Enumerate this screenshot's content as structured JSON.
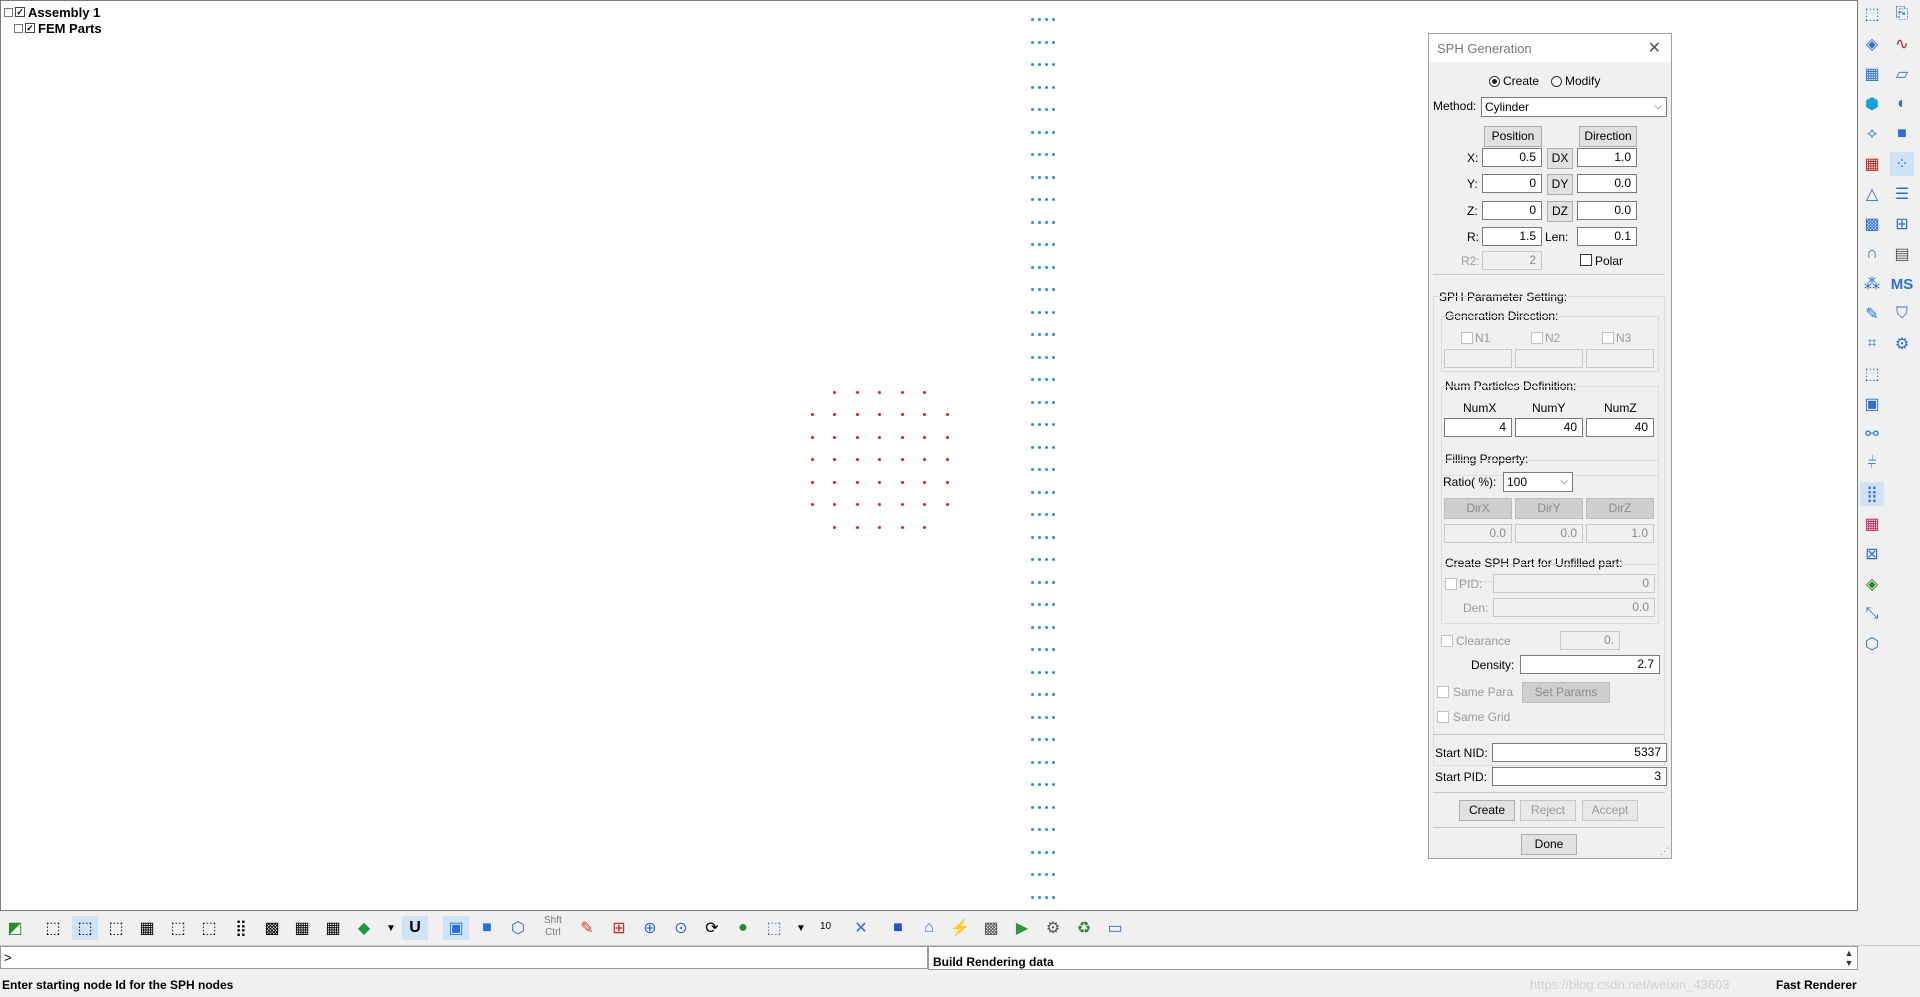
{
  "tree": {
    "root_label": "Assembly 1",
    "child_label": "FEM Parts"
  },
  "dialog": {
    "title": "SPH Generation",
    "close": "✕",
    "mode": {
      "create": "Create",
      "modify": "Modify",
      "selected": "Create"
    },
    "method_label": "Method:",
    "method_value": "Cylinder",
    "position_button": "Position",
    "direction_button": "Direction",
    "x_label": "X:",
    "y_label": "Y:",
    "z_label": "Z:",
    "r_label": "R:",
    "r2_label": "R2:",
    "x": "0.5",
    "y": "0",
    "z": "0",
    "r": "1.5",
    "r2": "2",
    "dx_button": "DX",
    "dy_button": "DY",
    "dz_button": "DZ",
    "dx": "1.0",
    "dy": "0.0",
    "dz": "0.0",
    "len_label": "Len:",
    "len": "0.1",
    "polar_label": "Polar",
    "param_setting": "SPH Parameter Setting:",
    "gen_direction": "Generation Direction:",
    "n1": "N1",
    "n2": "N2",
    "n3": "N3",
    "num_particles": "Num Particles Definition:",
    "numx_label": "NumX",
    "numy_label": "NumY",
    "numz_label": "NumZ",
    "numx": "4",
    "numy": "40",
    "numz": "40",
    "filling": "Filling Property:",
    "ratio_label": "Ratio( %):",
    "ratio_value": "100",
    "dirx": "DirX",
    "diry": "DirY",
    "dirz": "DirZ",
    "dirx_value": "0.0",
    "diry_value": "0.0",
    "dirz_value": "1.0",
    "unfilled": "Create SPH Part for Unfilled part:",
    "pid_label": "PID:",
    "pid": "0",
    "den_label": "Den:",
    "den": "0.0",
    "clearance_label": "Clearance",
    "clearance": "0.",
    "density_label": "Density:",
    "density": "2.7",
    "same_para": "Same Para",
    "set_params": "Set Params",
    "same_grid": "Same Grid",
    "start_nid_label": "Start NID:",
    "start_nid": "5337",
    "start_pid_label": "Start PID:",
    "start_pid": "3",
    "create_button": "Create",
    "reject_button": "Reject",
    "accept_button": "Accept",
    "done_button": "Done"
  },
  "bottom_toolbar": {
    "shift_label": "Shft",
    "ctrl_label": "Ctrl",
    "number_label": "10",
    "u_label": "U"
  },
  "right_toolbar": {
    "ms_label": "MS"
  },
  "command": {
    "prompt": ">",
    "output": "Build Rendering data"
  },
  "status": {
    "message": "Enter starting node Id for the SPH nodes",
    "watermark": "https://blog.csdn.net/weixin_43603",
    "renderer": "Fast Renderer"
  },
  "colors": {
    "red_particles": "#d42020",
    "blue_particles": "#2b8fd6"
  }
}
